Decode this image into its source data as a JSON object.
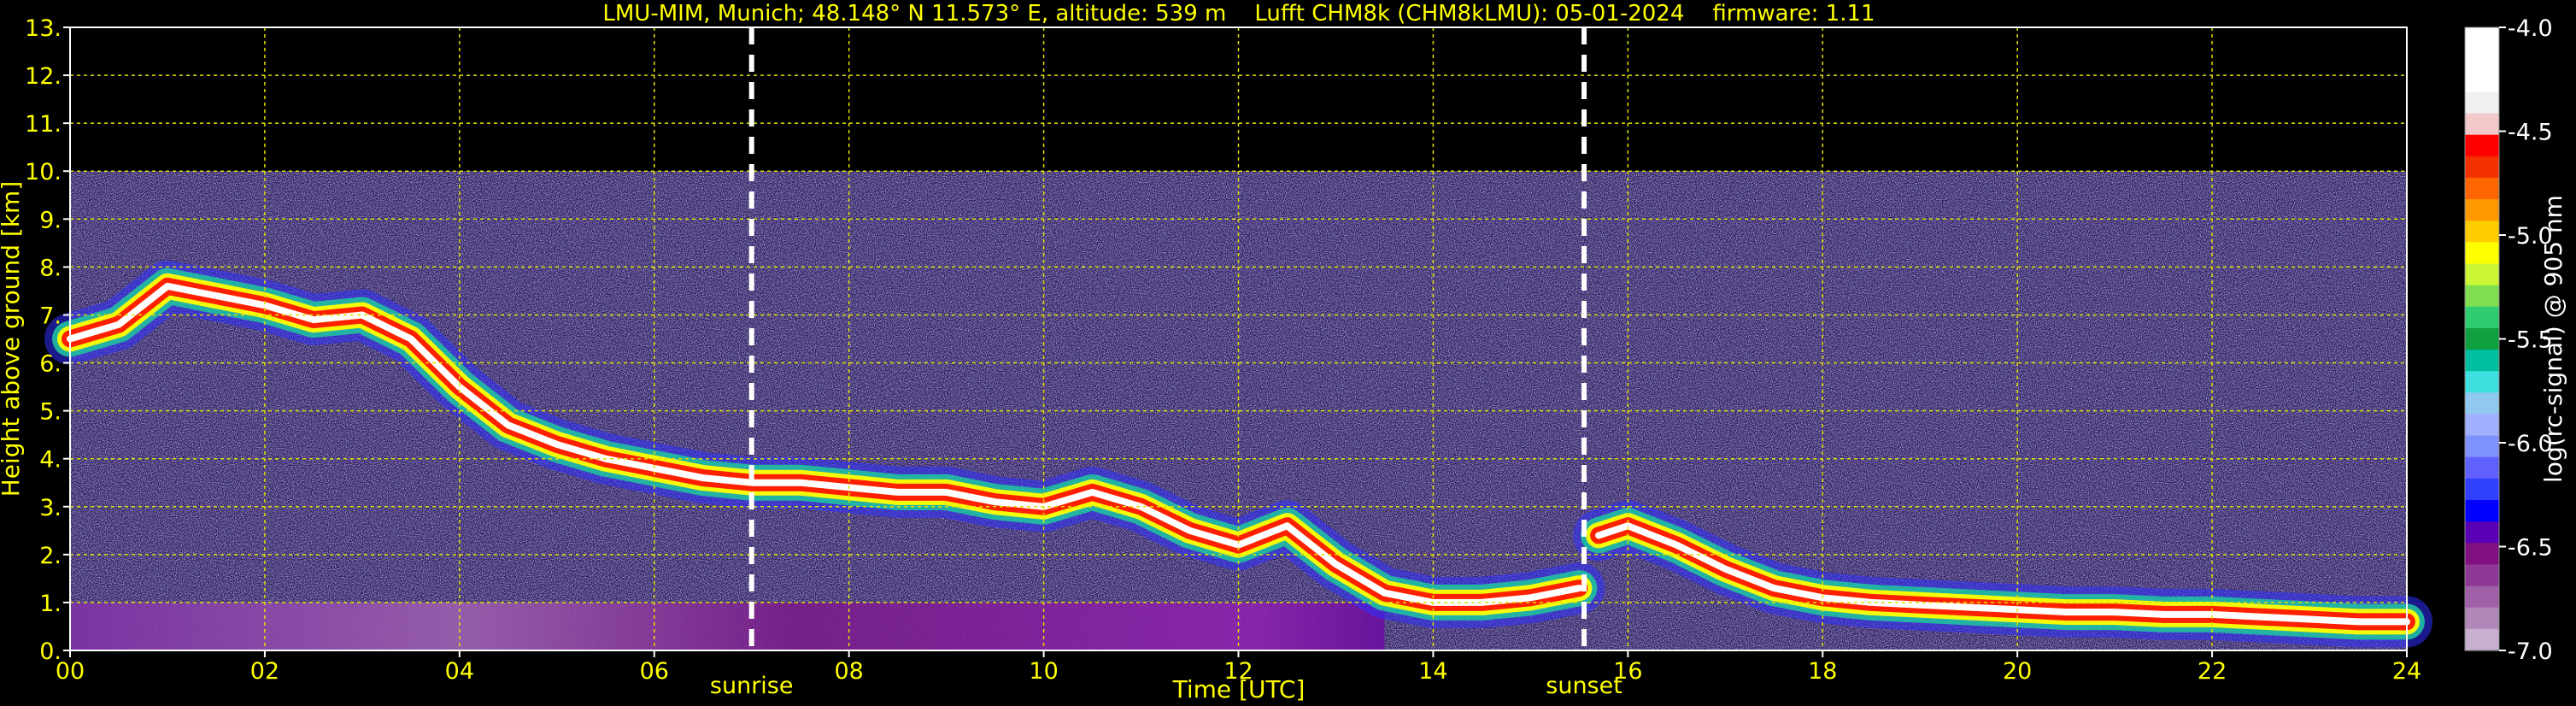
{
  "chart_data": {
    "type": "heatmap",
    "title": "LMU-MIM, Munich; 48.148° N 11.573° E, altitude: 539 m    Lufft CHM8k (CHM8kLMU): 05-01-2024    firmware: 1.11",
    "xlabel": "Time [UTC]",
    "ylabel": "Height above ground [km]",
    "xlim": [
      0,
      24
    ],
    "ylim": [
      0,
      13
    ],
    "x_ticks": [
      0,
      2,
      4,
      6,
      8,
      10,
      12,
      14,
      16,
      18,
      20,
      22,
      24
    ],
    "x_tick_labels": [
      "00",
      "02",
      "04",
      "06",
      "08",
      "10",
      "12",
      "14",
      "16",
      "18",
      "20",
      "22",
      "24"
    ],
    "y_ticks": [
      0,
      1,
      2,
      3,
      4,
      5,
      6,
      7,
      8,
      9,
      10,
      11,
      12,
      13
    ],
    "y_tick_labels": [
      "0.",
      "1.",
      "2.",
      "3.",
      "4.",
      "5.",
      "6.",
      "7.",
      "8.",
      "9.",
      "10.",
      "11.",
      "12.",
      "13."
    ],
    "grid": true,
    "measurement_top_km": 10,
    "markers": [
      {
        "label": "sunrise",
        "x": 7.0
      },
      {
        "label": "sunset",
        "x": 15.55
      }
    ],
    "colorbar": {
      "label": "log(rc-signal) @ 905 nm",
      "range": [
        -7.0,
        -4.0
      ],
      "ticks": [
        -4.0,
        -4.5,
        -5.0,
        -5.5,
        -6.0,
        -6.5,
        -7.0
      ],
      "tick_labels": [
        "-4.0",
        "-4.5",
        "-5.0",
        "-5.5",
        "-6.0",
        "-6.5",
        "-7.0"
      ],
      "colors": [
        "#ffffff",
        "#ffffff",
        "#ffffff",
        "#f0f0f0",
        "#f2c8c8",
        "#ff0000",
        "#f23000",
        "#ff6600",
        "#ff9900",
        "#ffcc00",
        "#ffff00",
        "#ccf533",
        "#7fdf50",
        "#30cc70",
        "#10a040",
        "#00c0a0",
        "#40e0e0",
        "#90c8f0",
        "#a0b0ff",
        "#7f90ff",
        "#6060ff",
        "#3040ff",
        "#0000ff",
        "#5a00b4",
        "#801080",
        "#903898",
        "#a060a8",
        "#b088b8",
        "#c8aed0"
      ]
    },
    "signal_layers": [
      {
        "description": "cloud layer",
        "x": [
          0.0,
          0.5,
          1.0,
          1.5,
          2.0,
          2.5,
          3.0,
          3.5,
          4.0,
          4.5,
          5.0,
          5.5,
          6.0,
          6.5,
          7.0,
          7.5,
          8.0,
          8.5,
          9.0,
          9.5,
          10.0,
          10.5,
          11.0,
          11.5,
          12.0,
          12.5,
          13.0,
          13.5,
          14.0,
          14.5,
          15.0,
          15.5
        ],
        "y": [
          6.5,
          6.8,
          7.6,
          7.4,
          7.2,
          6.9,
          7.0,
          6.5,
          5.5,
          4.7,
          4.3,
          4.0,
          3.8,
          3.6,
          3.5,
          3.5,
          3.4,
          3.3,
          3.3,
          3.1,
          3.0,
          3.3,
          3.0,
          2.5,
          2.2,
          2.6,
          1.8,
          1.2,
          1.0,
          1.0,
          1.1,
          1.3
        ]
      },
      {
        "description": "boundary layer",
        "x": [
          15.7,
          16.0,
          16.5,
          17.0,
          17.5,
          18.0,
          18.5,
          19.0,
          19.5,
          20.0,
          20.5,
          21.0,
          21.5,
          22.0,
          22.5,
          23.0,
          23.5,
          24.0
        ],
        "y": [
          2.4,
          2.6,
          2.2,
          1.7,
          1.3,
          1.1,
          1.0,
          0.95,
          0.9,
          0.85,
          0.8,
          0.8,
          0.75,
          0.75,
          0.7,
          0.65,
          0.6,
          0.6
        ]
      }
    ]
  }
}
